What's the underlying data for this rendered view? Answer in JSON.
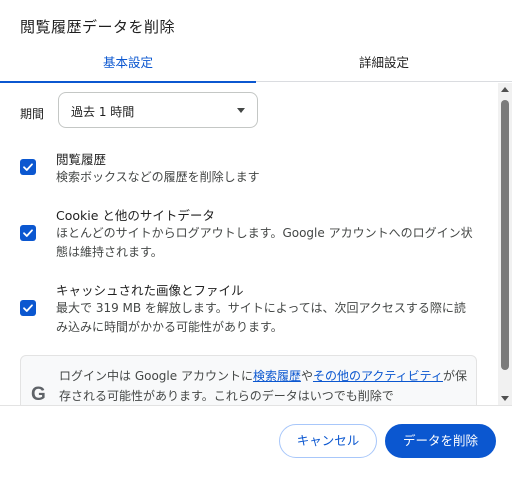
{
  "dialog": {
    "title": "閲覧履歴データを削除"
  },
  "tabs": [
    {
      "label": "基本設定",
      "active": true
    },
    {
      "label": "詳細設定",
      "active": false
    }
  ],
  "period": {
    "label": "期間",
    "value": "過去 1 時間"
  },
  "items": [
    {
      "title": "閲覧履歴",
      "desc": "検索ボックスなどの履歴を削除します",
      "checked": true
    },
    {
      "title": "Cookie と他のサイトデータ",
      "desc": "ほとんどのサイトからログアウトします。Google アカウントへのログイン状態は維持されます。",
      "checked": true
    },
    {
      "title": "キャッシュされた画像とファイル",
      "desc": "最大で 319 MB を解放します。サイトによっては、次回アクセスする際に読み込みに時間がかかる可能性があります。",
      "checked": true
    }
  ],
  "info": {
    "text_before": "ログイン中は Google アカウントに",
    "link1": "検索履歴",
    "text_mid": "や",
    "link2": "その他のアクティビティ",
    "text_after": "が保存される可能性があります。これらのデータはいつでも削除で"
  },
  "buttons": {
    "cancel": "キャンセル",
    "delete": "データを削除"
  },
  "colors": {
    "accent": "#0b57d0",
    "text": "#1f1f1f",
    "secondary_text": "#444746"
  },
  "icons": {
    "checkbox": "checkmark-icon",
    "dropdown": "caret-down-icon",
    "logo": "google-g-icon"
  }
}
